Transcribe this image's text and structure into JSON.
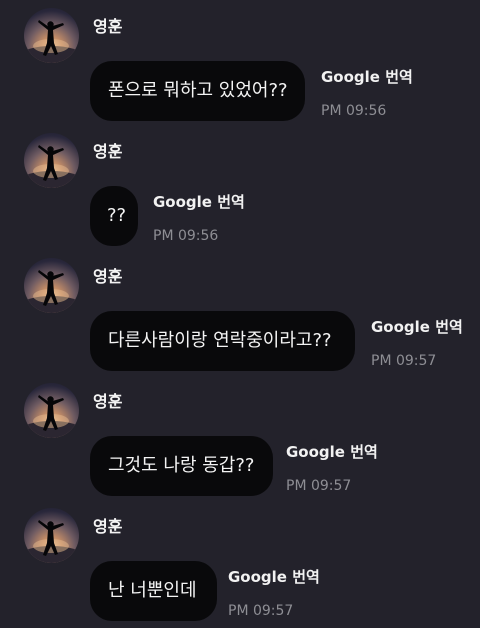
{
  "messages": [
    {
      "sender": "영훈",
      "text": "폰으로 뭐하고 있었어??",
      "translator": "Google 번역",
      "time": "PM 09:56"
    },
    {
      "sender": "영훈",
      "text": "??",
      "translator": "Google 번역",
      "time": "PM 09:56"
    },
    {
      "sender": "영훈",
      "text": "다른사람이랑 연락중이라고??",
      "translator": "Google 번역",
      "time": "PM 09:57"
    },
    {
      "sender": "영훈",
      "text": "그것도 나랑 동갑??",
      "translator": "Google 번역",
      "time": "PM 09:57"
    },
    {
      "sender": "영훈",
      "text": "난 너뿐인데",
      "translator": "Google 번역",
      "time": "PM 09:57"
    }
  ],
  "colors": {
    "background": "#23222b",
    "bubble": "#09090b",
    "text": "#ffffff",
    "time": "#8e8e94"
  }
}
